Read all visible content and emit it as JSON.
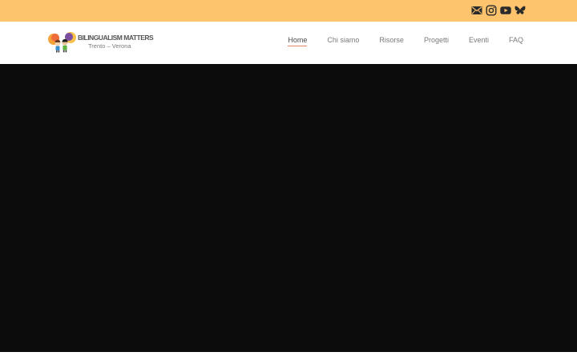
{
  "colors": {
    "topbar": "#fdc46d",
    "hero": "#0c0c0c",
    "nav_active_underline": "#e8836b",
    "icon": "#2b2b2b"
  },
  "social": {
    "icons": [
      "email-icon",
      "instagram-icon",
      "youtube-icon",
      "bluesky-icon"
    ]
  },
  "logo": {
    "title": "BILINGUALISM MATTERS",
    "subtitle": "Trento – Verona"
  },
  "nav": {
    "items": [
      {
        "label": "Home",
        "active": true
      },
      {
        "label": "Chi siamo",
        "active": false
      },
      {
        "label": "Risorse",
        "active": false
      },
      {
        "label": "Progetti",
        "active": false
      },
      {
        "label": "Eventi",
        "active": false
      },
      {
        "label": "FAQ",
        "active": false
      }
    ]
  }
}
